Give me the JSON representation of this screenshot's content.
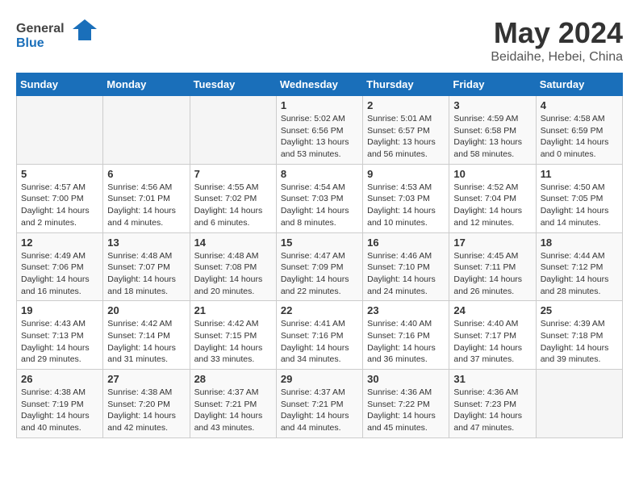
{
  "header": {
    "logo_general": "General",
    "logo_blue": "Blue",
    "month": "May 2024",
    "location": "Beidaihe, Hebei, China"
  },
  "weekdays": [
    "Sunday",
    "Monday",
    "Tuesday",
    "Wednesday",
    "Thursday",
    "Friday",
    "Saturday"
  ],
  "weeks": [
    [
      {
        "day": "",
        "content": ""
      },
      {
        "day": "",
        "content": ""
      },
      {
        "day": "",
        "content": ""
      },
      {
        "day": "1",
        "content": "Sunrise: 5:02 AM\nSunset: 6:56 PM\nDaylight: 13 hours and 53 minutes."
      },
      {
        "day": "2",
        "content": "Sunrise: 5:01 AM\nSunset: 6:57 PM\nDaylight: 13 hours and 56 minutes."
      },
      {
        "day": "3",
        "content": "Sunrise: 4:59 AM\nSunset: 6:58 PM\nDaylight: 13 hours and 58 minutes."
      },
      {
        "day": "4",
        "content": "Sunrise: 4:58 AM\nSunset: 6:59 PM\nDaylight: 14 hours and 0 minutes."
      }
    ],
    [
      {
        "day": "5",
        "content": "Sunrise: 4:57 AM\nSunset: 7:00 PM\nDaylight: 14 hours and 2 minutes."
      },
      {
        "day": "6",
        "content": "Sunrise: 4:56 AM\nSunset: 7:01 PM\nDaylight: 14 hours and 4 minutes."
      },
      {
        "day": "7",
        "content": "Sunrise: 4:55 AM\nSunset: 7:02 PM\nDaylight: 14 hours and 6 minutes."
      },
      {
        "day": "8",
        "content": "Sunrise: 4:54 AM\nSunset: 7:03 PM\nDaylight: 14 hours and 8 minutes."
      },
      {
        "day": "9",
        "content": "Sunrise: 4:53 AM\nSunset: 7:03 PM\nDaylight: 14 hours and 10 minutes."
      },
      {
        "day": "10",
        "content": "Sunrise: 4:52 AM\nSunset: 7:04 PM\nDaylight: 14 hours and 12 minutes."
      },
      {
        "day": "11",
        "content": "Sunrise: 4:50 AM\nSunset: 7:05 PM\nDaylight: 14 hours and 14 minutes."
      }
    ],
    [
      {
        "day": "12",
        "content": "Sunrise: 4:49 AM\nSunset: 7:06 PM\nDaylight: 14 hours and 16 minutes."
      },
      {
        "day": "13",
        "content": "Sunrise: 4:48 AM\nSunset: 7:07 PM\nDaylight: 14 hours and 18 minutes."
      },
      {
        "day": "14",
        "content": "Sunrise: 4:48 AM\nSunset: 7:08 PM\nDaylight: 14 hours and 20 minutes."
      },
      {
        "day": "15",
        "content": "Sunrise: 4:47 AM\nSunset: 7:09 PM\nDaylight: 14 hours and 22 minutes."
      },
      {
        "day": "16",
        "content": "Sunrise: 4:46 AM\nSunset: 7:10 PM\nDaylight: 14 hours and 24 minutes."
      },
      {
        "day": "17",
        "content": "Sunrise: 4:45 AM\nSunset: 7:11 PM\nDaylight: 14 hours and 26 minutes."
      },
      {
        "day": "18",
        "content": "Sunrise: 4:44 AM\nSunset: 7:12 PM\nDaylight: 14 hours and 28 minutes."
      }
    ],
    [
      {
        "day": "19",
        "content": "Sunrise: 4:43 AM\nSunset: 7:13 PM\nDaylight: 14 hours and 29 minutes."
      },
      {
        "day": "20",
        "content": "Sunrise: 4:42 AM\nSunset: 7:14 PM\nDaylight: 14 hours and 31 minutes."
      },
      {
        "day": "21",
        "content": "Sunrise: 4:42 AM\nSunset: 7:15 PM\nDaylight: 14 hours and 33 minutes."
      },
      {
        "day": "22",
        "content": "Sunrise: 4:41 AM\nSunset: 7:16 PM\nDaylight: 14 hours and 34 minutes."
      },
      {
        "day": "23",
        "content": "Sunrise: 4:40 AM\nSunset: 7:16 PM\nDaylight: 14 hours and 36 minutes."
      },
      {
        "day": "24",
        "content": "Sunrise: 4:40 AM\nSunset: 7:17 PM\nDaylight: 14 hours and 37 minutes."
      },
      {
        "day": "25",
        "content": "Sunrise: 4:39 AM\nSunset: 7:18 PM\nDaylight: 14 hours and 39 minutes."
      }
    ],
    [
      {
        "day": "26",
        "content": "Sunrise: 4:38 AM\nSunset: 7:19 PM\nDaylight: 14 hours and 40 minutes."
      },
      {
        "day": "27",
        "content": "Sunrise: 4:38 AM\nSunset: 7:20 PM\nDaylight: 14 hours and 42 minutes."
      },
      {
        "day": "28",
        "content": "Sunrise: 4:37 AM\nSunset: 7:21 PM\nDaylight: 14 hours and 43 minutes."
      },
      {
        "day": "29",
        "content": "Sunrise: 4:37 AM\nSunset: 7:21 PM\nDaylight: 14 hours and 44 minutes."
      },
      {
        "day": "30",
        "content": "Sunrise: 4:36 AM\nSunset: 7:22 PM\nDaylight: 14 hours and 45 minutes."
      },
      {
        "day": "31",
        "content": "Sunrise: 4:36 AM\nSunset: 7:23 PM\nDaylight: 14 hours and 47 minutes."
      },
      {
        "day": "",
        "content": ""
      }
    ]
  ]
}
